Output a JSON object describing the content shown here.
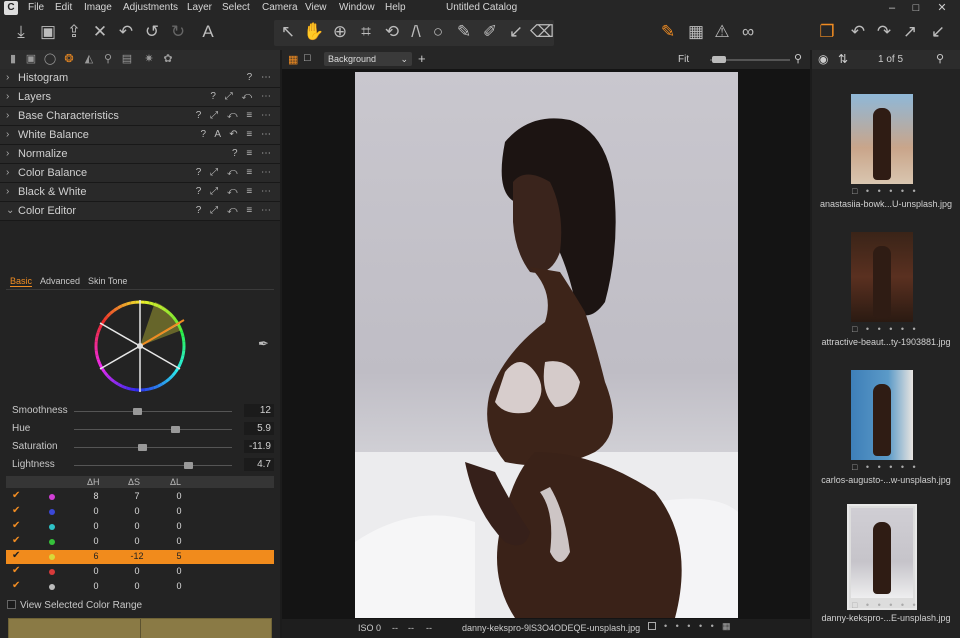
{
  "app": {
    "window_title": "Untitled Catalog"
  },
  "menu": [
    "File",
    "Edit",
    "Image",
    "Adjustments",
    "Layer",
    "Select",
    "Camera",
    "View",
    "Window",
    "Help"
  ],
  "window_controls": [
    "–",
    "□",
    "✕"
  ],
  "left_tabs": [
    "folder",
    "camera",
    "lens",
    "color",
    "exposure",
    "details",
    "adjust",
    "settings",
    "batch"
  ],
  "tools": [
    {
      "name": "Histogram",
      "icons": "? ⋯",
      "open": false
    },
    {
      "name": "Layers",
      "icons": "? ⤢ ↶ ⋯",
      "open": false
    },
    {
      "name": "Base Characteristics",
      "icons": "? ⤢ ↶ ≡ ⋯",
      "open": false
    },
    {
      "name": "White Balance",
      "icons": "? A ↶ ≡ ⋯",
      "open": false
    },
    {
      "name": "Normalize",
      "icons": "? ≡ ⋯",
      "open": false
    },
    {
      "name": "Color Balance",
      "icons": "? ⤢ ↶ ≡ ⋯",
      "open": false
    },
    {
      "name": "Black & White",
      "icons": "? ⤢ ↶ ≡ ⋯",
      "open": false
    },
    {
      "name": "Color Editor",
      "icons": "? ⤢ ↶ ≡ ⋯",
      "open": true
    }
  ],
  "color_editor": {
    "tabs": [
      "Basic",
      "Advanced",
      "Skin Tone"
    ],
    "active_tab": "Basic",
    "sliders": [
      {
        "label": "Smoothness",
        "value": "12",
        "pos": 0.4
      },
      {
        "label": "Hue",
        "value": "5.9",
        "pos": 0.64
      },
      {
        "label": "Saturation",
        "value": "-11.9",
        "pos": 0.43
      },
      {
        "label": "Lightness",
        "value": "4.7",
        "pos": 0.72
      }
    ],
    "table_headers": [
      "ΔH",
      "ΔS",
      "ΔL"
    ],
    "rows": [
      {
        "color": "#d23fd6",
        "dh": "8",
        "ds": "7",
        "dl": "0",
        "selected": false
      },
      {
        "color": "#3b48d8",
        "dh": "0",
        "ds": "0",
        "dl": "0",
        "selected": false
      },
      {
        "color": "#2ec3c8",
        "dh": "0",
        "ds": "0",
        "dl": "0",
        "selected": false
      },
      {
        "color": "#36c23b",
        "dh": "0",
        "ds": "0",
        "dl": "0",
        "selected": false
      },
      {
        "color": "#d8d83a",
        "dh": "6",
        "ds": "-12",
        "dl": "5",
        "selected": true
      },
      {
        "color": "#d83a3a",
        "dh": "0",
        "ds": "0",
        "dl": "0",
        "selected": false
      },
      {
        "color": "#bbbbbb",
        "dh": "0",
        "ds": "0",
        "dl": "0",
        "selected": false
      }
    ],
    "view_range_label": "View Selected Color Range",
    "range_color": "#8a7a45"
  },
  "viewer": {
    "background_select": "Background",
    "fit_label": "Fit",
    "status": {
      "iso": "ISO 0",
      "dashes": [
        "--",
        "--",
        "--"
      ],
      "filename": "danny-kekspro-9lS3O4ODEQE-unsplash.jpg"
    }
  },
  "browser": {
    "counter": "1 of 5",
    "thumbnails": [
      {
        "caption": "anastasiia-bowk...U-unsplash.jpg",
        "selected": false
      },
      {
        "caption": "attractive-beaut...ty-1903881.jpg",
        "selected": false
      },
      {
        "caption": "carlos-augusto-...w-unsplash.jpg",
        "selected": false
      },
      {
        "caption": "danny-kekspro-...E-unsplash.jpg",
        "selected": true
      }
    ]
  },
  "accent": "#f08c22"
}
